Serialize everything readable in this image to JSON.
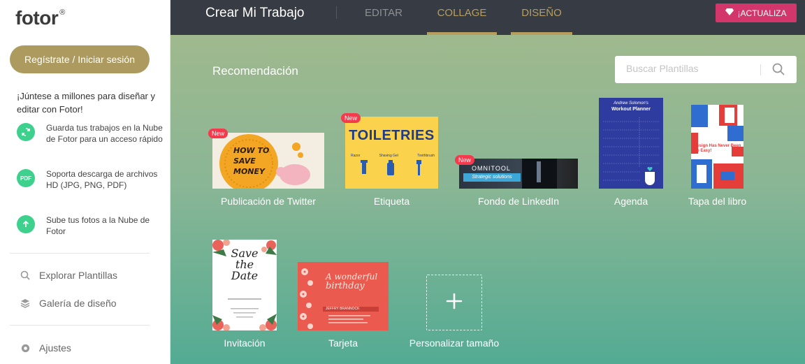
{
  "sidebar": {
    "logo": "fotor",
    "logo_mark": "®",
    "login_label": "Regístrate / Iniciar sesión",
    "promo": "¡Júntese a millones para diseñar y editar con Fotor!",
    "features": [
      {
        "icon": "sync-icon",
        "text": "Guarda tus trabajos en la Nube de Fotor para un acceso rápido"
      },
      {
        "icon": "pdf-icon",
        "icon_text": "PDF",
        "text": "Soporta descarga de archivos HD (JPG, PNG, PDF)"
      },
      {
        "icon": "upload-icon",
        "text": "Sube tus fotos a la Nube de Fotor"
      }
    ],
    "nav": [
      {
        "icon": "search-icon",
        "label": "Explorar Plantillas"
      },
      {
        "icon": "layers-icon",
        "label": "Galería de diseño"
      },
      {
        "icon": "gear-icon",
        "label": "Ajustes"
      }
    ]
  },
  "topbar": {
    "title": "Crear Mi Trabajo",
    "tabs": [
      {
        "label": "EDITAR",
        "active": false
      },
      {
        "label": "COLLAGE",
        "active": true
      },
      {
        "label": "DISEÑO",
        "active": true
      }
    ],
    "upgrade_label": "¡ACTUALIZA",
    "upgrade_icon": "diamond-icon",
    "upgrade_color": "#d2366b",
    "accent_color": "#b79e5e"
  },
  "main": {
    "section_title": "Recomendación",
    "search_placeholder": "Buscar Plantillas",
    "badge": "New",
    "templates": [
      {
        "label": "Publicación de Twitter",
        "new": true,
        "thumb_text": [
          "HOW TO",
          "SAVE",
          "MONEY"
        ]
      },
      {
        "label": "Etiqueta",
        "new": true,
        "thumb_text": [
          "TOILETRIES",
          "Razor",
          "Shaving Gel",
          "Toothbrush"
        ]
      },
      {
        "label": "Fondo de LinkedIn",
        "new": true,
        "thumb_text": [
          "OMNITOOL",
          "Strategic solutions"
        ]
      },
      {
        "label": "Agenda",
        "new": false,
        "thumb_text": [
          "Andrew Solomon's",
          "Workout Planner"
        ]
      },
      {
        "label": "Tapa del libro",
        "new": false,
        "thumb_text": [
          "Design Has Never Been So Easy!"
        ]
      },
      {
        "label": "Invitación",
        "new": false,
        "thumb_text": [
          "Save",
          "the",
          "Date"
        ]
      },
      {
        "label": "Tarjeta",
        "new": false,
        "thumb_text": [
          "A wonderful",
          "birthday",
          "JEFFRY BRANNOCK"
        ]
      },
      {
        "label": "Personalizar tamaño",
        "new": false
      }
    ]
  }
}
